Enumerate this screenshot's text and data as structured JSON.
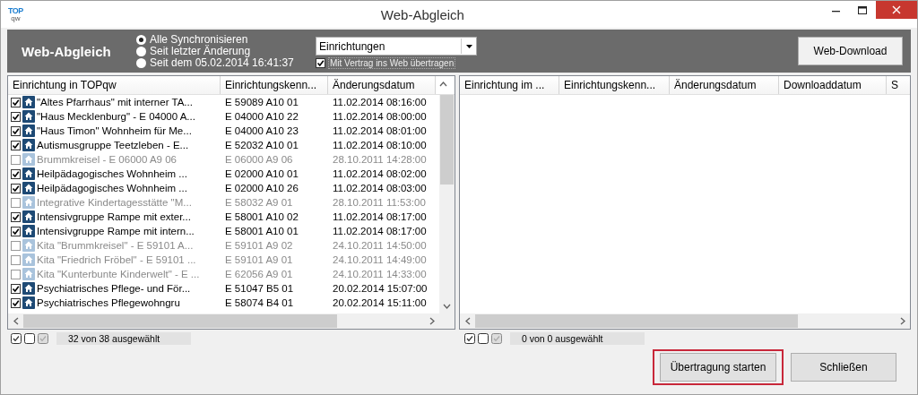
{
  "window": {
    "logo": {
      "upper": "TOP",
      "lower": "qw"
    },
    "title": "Web-Abgleich"
  },
  "toolbar": {
    "heading": "Web-Abgleich",
    "sync_options": [
      {
        "label": "Alle Synchronisieren",
        "selected": true
      },
      {
        "label": "Seit letzter Änderung",
        "selected": false
      },
      {
        "label": "Seit dem 05.02.2014 16:41:37",
        "selected": false
      }
    ],
    "dropdown": {
      "value": "Einrichtungen"
    },
    "contract_checkbox": {
      "label": "Mit Vertrag ins Web übertragen",
      "checked": true
    },
    "download_button": "Web-Download"
  },
  "left_list": {
    "columns": [
      "Einrichtung in TOPqw",
      "Einrichtungskenn...",
      "Änderungsdatum"
    ],
    "rows": [
      {
        "name": "\"Altes Pfarrhaus\" mit interner TA...",
        "code": "E 59089 A10 01",
        "date": "11.02.2014 08:16:00",
        "checked": true
      },
      {
        "name": "\"Haus Mecklenburg\" - E 04000 A...",
        "code": "E 04000 A10 22",
        "date": "11.02.2014 08:00:00",
        "checked": true
      },
      {
        "name": "\"Haus Timon\" Wohnheim für Me...",
        "code": "E 04000 A10 23",
        "date": "11.02.2014 08:01:00",
        "checked": true
      },
      {
        "name": "Autismusgruppe Teetzleben  - E...",
        "code": "E 52032 A10 01",
        "date": "11.02.2014 08:10:00",
        "checked": true
      },
      {
        "name": "Brummkreisel - E 06000 A9 06",
        "code": "E 06000 A9 06",
        "date": "28.10.2011 14:28:00",
        "checked": false
      },
      {
        "name": "Heilpädagogisches Wohnheim ...",
        "code": "E 02000 A10 01",
        "date": "11.02.2014 08:02:00",
        "checked": true
      },
      {
        "name": "Heilpädagogisches Wohnheim ...",
        "code": "E 02000 A10 26",
        "date": "11.02.2014 08:03:00",
        "checked": true
      },
      {
        "name": "Integrative Kindertagesstätte \"M...",
        "code": "E 58032 A9 01",
        "date": "28.10.2011 11:53:00",
        "checked": false
      },
      {
        "name": "Intensivgruppe Rampe mit exter...",
        "code": "E 58001 A10 02",
        "date": "11.02.2014 08:17:00",
        "checked": true
      },
      {
        "name": "Intensivgruppe Rampe mit intern...",
        "code": "E 58001 A10 01",
        "date": "11.02.2014 08:17:00",
        "checked": true
      },
      {
        "name": "Kita \"Brummkreisel\" - E 59101 A...",
        "code": "E 59101 A9 02",
        "date": "24.10.2011 14:50:00",
        "checked": false
      },
      {
        "name": "Kita \"Friedrich Fröbel\" - E 59101 ...",
        "code": "E 59101 A9 01",
        "date": "24.10.2011 14:49:00",
        "checked": false
      },
      {
        "name": "Kita \"Kunterbunte Kinderwelt\" - E ...",
        "code": "E 62056 A9 01",
        "date": "24.10.2011 14:33:00",
        "checked": false
      },
      {
        "name": "Psychiatrisches Pflege- und För...",
        "code": "E 51047 B5 01",
        "date": "20.02.2014 15:07:00",
        "checked": true
      },
      {
        "name": "Psychiatrisches Pflegewohngru",
        "code": "E 58074 B4 01",
        "date": "20.02.2014 15:11:00",
        "checked": true
      }
    ],
    "status": "32 von 38 ausgewählt"
  },
  "right_list": {
    "columns": [
      "Einrichtung im ...",
      "Einrichtungskenn...",
      "Änderungsdatum",
      "Downloaddatum",
      "S"
    ],
    "status": "0 von 0 ausgewählt"
  },
  "buttons": [
    {
      "label": "Übertragung starten",
      "highlighted": true
    },
    {
      "label": "Schließen",
      "highlighted": false
    }
  ]
}
